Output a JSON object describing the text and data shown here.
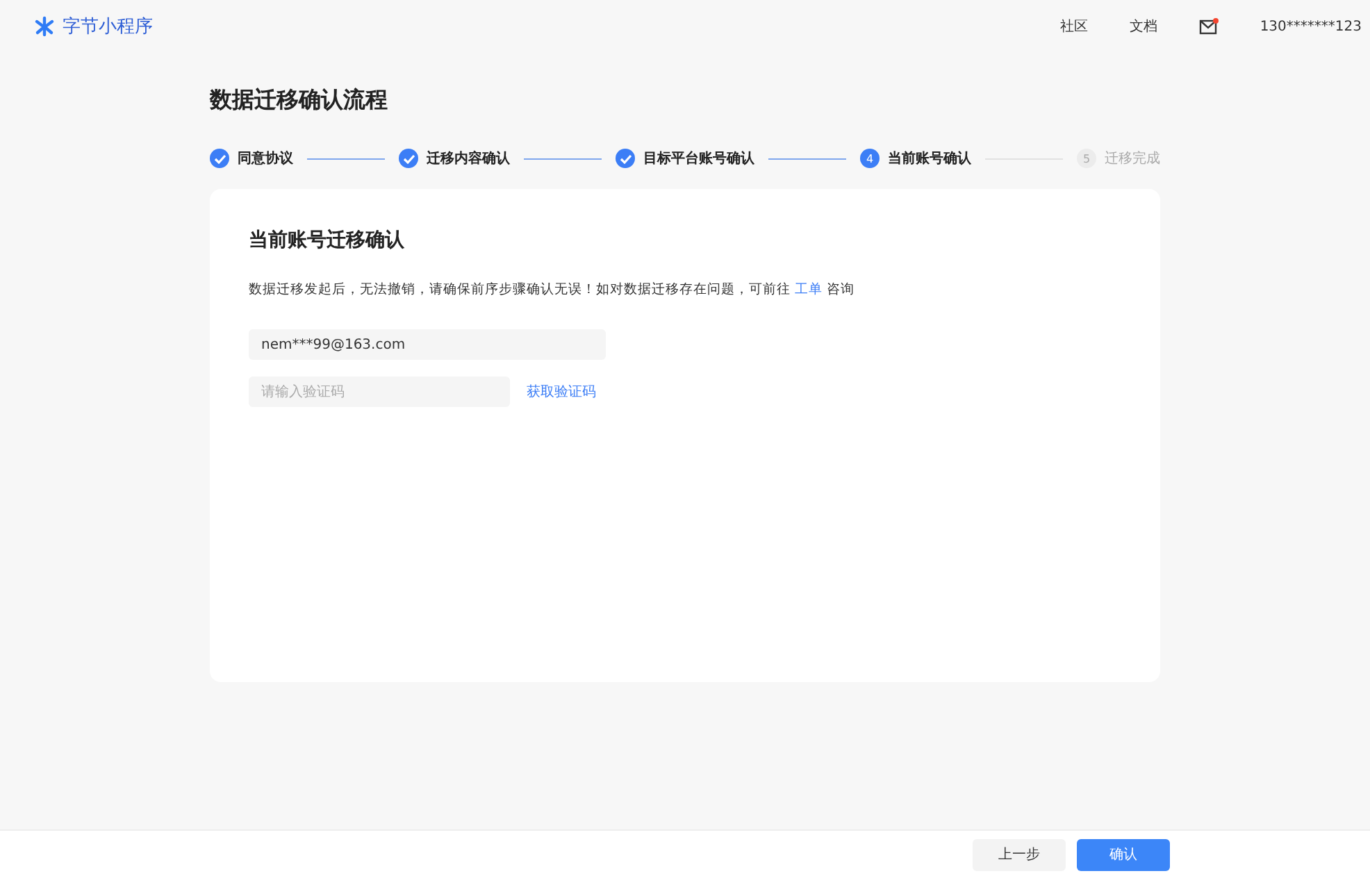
{
  "header": {
    "logo": "字节小程序",
    "nav": [
      "社区",
      "文档"
    ],
    "mail_unread": true,
    "account": "130*******123"
  },
  "page_title": "数据迁移确认流程",
  "steps": [
    {
      "label": "同意协议",
      "kind": "done"
    },
    {
      "label": "迁移内容确认",
      "kind": "done"
    },
    {
      "label": "目标平台账号确认",
      "kind": "done"
    },
    {
      "number": "4",
      "label": "当前账号确认",
      "kind": "current"
    },
    {
      "number": "5",
      "label": "迁移完成",
      "kind": "pending"
    }
  ],
  "card": {
    "title": "当前账号迁移确认",
    "notice_before": "数据迁移发起后，无法撤销，请确保前序步骤确认无误！如对数据迁移存在问题，可前往",
    "notice_link": "工单",
    "notice_after": "咨询",
    "email": {
      "value": "nem***99@163.com"
    },
    "code": {
      "placeholder": "请输入验证码"
    },
    "get_code": "获取验证码"
  },
  "footer": {
    "buttons": [
      {
        "label": "上一步",
        "kind": "secondary"
      },
      {
        "label": "确认",
        "kind": "primary"
      }
    ]
  }
}
